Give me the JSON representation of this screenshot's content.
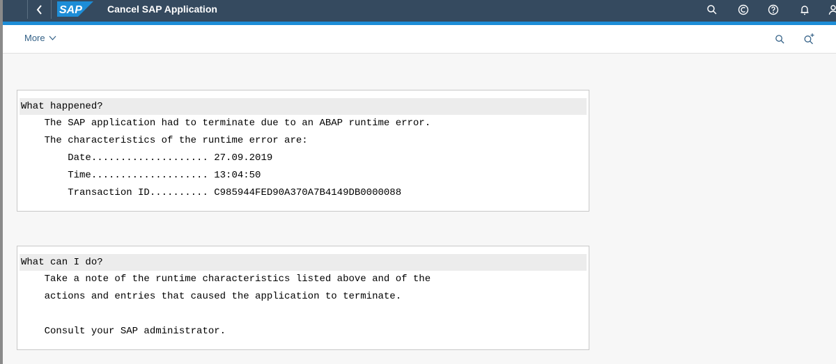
{
  "shell": {
    "title": "Cancel SAP Application",
    "logo_text": "SAP",
    "colors": {
      "shell_bg": "#354a5f",
      "accent": "#1d8dd7",
      "link": "#346187"
    }
  },
  "toolbar": {
    "more_label": "More"
  },
  "panel1": {
    "heading": "What happened?",
    "lines": [
      "    The SAP application had to terminate due to an ABAP runtime error.",
      "    The characteristics of the runtime error are:",
      "        Date.................... 27.09.2019",
      "        Time.................... 13:04:50",
      "        Transaction ID.......... C985944FED90A370A7B4149DB0000088"
    ]
  },
  "panel2": {
    "heading": "What can I do?",
    "lines": [
      "    Take a note of the runtime characteristics listed above and of the",
      "    actions and entries that caused the application to terminate.",
      "",
      "    Consult your SAP administrator."
    ]
  }
}
